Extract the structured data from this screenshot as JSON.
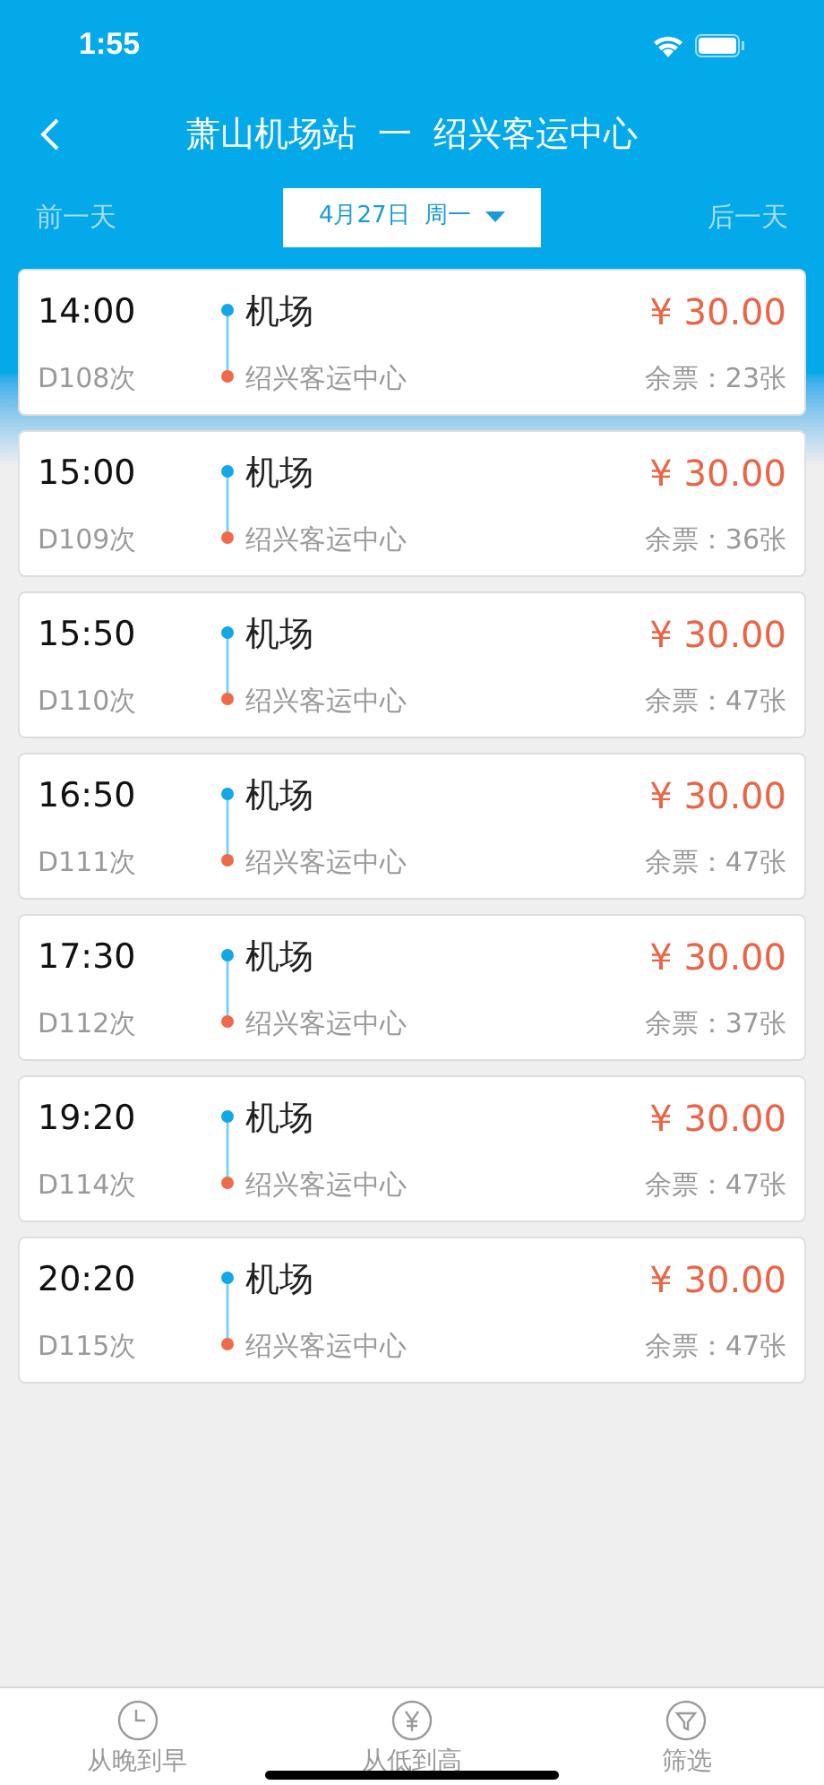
{
  "status_bar": {
    "time": "1:55"
  },
  "nav": {
    "title": "萧山机场站  一  绍兴客运中心"
  },
  "date_bar": {
    "prev": "前一天",
    "date": "4月27日  周一",
    "next": "后一天"
  },
  "trips": [
    {
      "time": "14:00",
      "train": "D108次",
      "from": "机场",
      "to": "绍兴客运中心",
      "price": "¥ 30.00",
      "remaining": "余票：23张"
    },
    {
      "time": "15:00",
      "train": "D109次",
      "from": "机场",
      "to": "绍兴客运中心",
      "price": "¥ 30.00",
      "remaining": "余票：36张"
    },
    {
      "time": "15:50",
      "train": "D110次",
      "from": "机场",
      "to": "绍兴客运中心",
      "price": "¥ 30.00",
      "remaining": "余票：47张"
    },
    {
      "time": "16:50",
      "train": "D111次",
      "from": "机场",
      "to": "绍兴客运中心",
      "price": "¥ 30.00",
      "remaining": "余票：47张"
    },
    {
      "time": "17:30",
      "train": "D112次",
      "from": "机场",
      "to": "绍兴客运中心",
      "price": "¥ 30.00",
      "remaining": "余票：37张"
    },
    {
      "time": "19:20",
      "train": "D114次",
      "from": "机场",
      "to": "绍兴客运中心",
      "price": "¥ 30.00",
      "remaining": "余票：47张"
    },
    {
      "time": "20:20",
      "train": "D115次",
      "from": "机场",
      "to": "绍兴客运中心",
      "price": "¥ 30.00",
      "remaining": "余票：47张"
    }
  ],
  "tab_bar": [
    {
      "kind": "clock",
      "label": "从晚到早"
    },
    {
      "kind": "yen",
      "label": "从低到高"
    },
    {
      "kind": "filter",
      "label": "筛选"
    }
  ]
}
